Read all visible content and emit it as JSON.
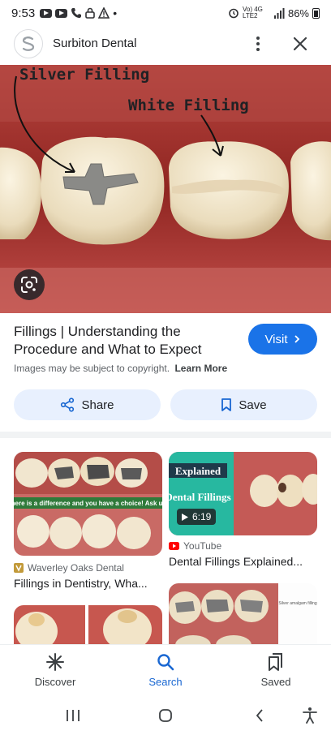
{
  "status_bar": {
    "time": "9:53",
    "network": "Vo) 4G LTE2",
    "battery": "86%"
  },
  "header": {
    "site_name": "Surbiton Dental"
  },
  "hero": {
    "label_silver": "Silver Filling",
    "label_white": "White Filling"
  },
  "result": {
    "title": "Fillings | Understanding the Procedure and What to Expect",
    "visit_label": "Visit",
    "copyright_text": "Images may be subject to copyright.",
    "learn_more": "Learn More",
    "share_label": "Share",
    "save_label": "Save"
  },
  "related": [
    {
      "source": "Waverley Oaks Dental",
      "title": "Fillings in Dentistry, Wha...",
      "image_caption": "There is a difference and you have a choice! Ask us."
    },
    {
      "source": "YouTube",
      "title": "Dental Fillings Explained...",
      "badge": "Explained",
      "image_text": "Dental Fillings",
      "duration": "6:19"
    },
    {
      "image_text": "Silver amalgam filling"
    }
  ],
  "bottom_nav": {
    "discover": "Discover",
    "search": "Search",
    "saved": "Saved"
  },
  "colors": {
    "accent": "#1a73e8",
    "pill_bg": "#e8f0fe",
    "active_tab": "#1967d2"
  }
}
